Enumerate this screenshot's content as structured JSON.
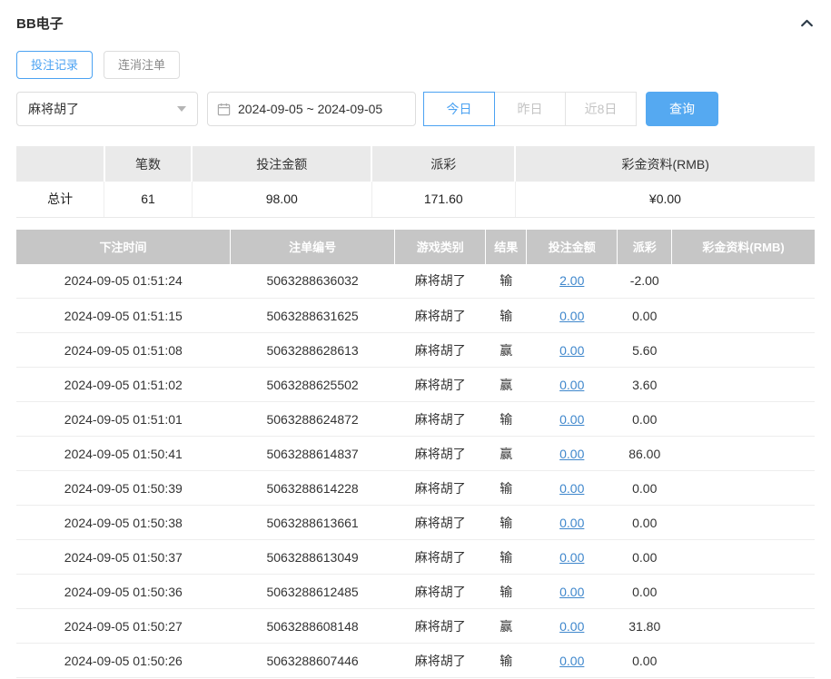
{
  "header": {
    "title": "BB电子"
  },
  "tabs": [
    {
      "label": "投注记录",
      "active": true
    },
    {
      "label": "连消注单",
      "active": false
    }
  ],
  "filters": {
    "game_select": "麻将胡了",
    "date_range": "2024-09-05 ~ 2024-09-05",
    "quick_buttons": [
      {
        "label": "今日",
        "active": true
      },
      {
        "label": "昨日",
        "active": false
      },
      {
        "label": "近8日",
        "active": false
      }
    ],
    "search_label": "查询"
  },
  "summary": {
    "headers": [
      "",
      "笔数",
      "投注金额",
      "派彩",
      "彩金资料(RMB)"
    ],
    "total_label": "总计",
    "count": "61",
    "bet_amount": "98.00",
    "payout": "171.60",
    "bonus": "¥0.00"
  },
  "table": {
    "headers": [
      "下注时间",
      "注单编号",
      "游戏类别",
      "结果",
      "投注金额",
      "派彩",
      "彩金资料(RMB)"
    ],
    "rows": [
      {
        "time": "2024-09-05 01:51:24",
        "order": "5063288636032",
        "game": "麻将胡了",
        "result": "输",
        "bet": "2.00",
        "payout": "-2.00",
        "bonus": ""
      },
      {
        "time": "2024-09-05 01:51:15",
        "order": "5063288631625",
        "game": "麻将胡了",
        "result": "输",
        "bet": "0.00",
        "payout": "0.00",
        "bonus": ""
      },
      {
        "time": "2024-09-05 01:51:08",
        "order": "5063288628613",
        "game": "麻将胡了",
        "result": "赢",
        "bet": "0.00",
        "payout": "5.60",
        "bonus": ""
      },
      {
        "time": "2024-09-05 01:51:02",
        "order": "5063288625502",
        "game": "麻将胡了",
        "result": "赢",
        "bet": "0.00",
        "payout": "3.60",
        "bonus": ""
      },
      {
        "time": "2024-09-05 01:51:01",
        "order": "5063288624872",
        "game": "麻将胡了",
        "result": "输",
        "bet": "0.00",
        "payout": "0.00",
        "bonus": ""
      },
      {
        "time": "2024-09-05 01:50:41",
        "order": "5063288614837",
        "game": "麻将胡了",
        "result": "赢",
        "bet": "0.00",
        "payout": "86.00",
        "bonus": ""
      },
      {
        "time": "2024-09-05 01:50:39",
        "order": "5063288614228",
        "game": "麻将胡了",
        "result": "输",
        "bet": "0.00",
        "payout": "0.00",
        "bonus": ""
      },
      {
        "time": "2024-09-05 01:50:38",
        "order": "5063288613661",
        "game": "麻将胡了",
        "result": "输",
        "bet": "0.00",
        "payout": "0.00",
        "bonus": ""
      },
      {
        "time": "2024-09-05 01:50:37",
        "order": "5063288613049",
        "game": "麻将胡了",
        "result": "输",
        "bet": "0.00",
        "payout": "0.00",
        "bonus": ""
      },
      {
        "time": "2024-09-05 01:50:36",
        "order": "5063288612485",
        "game": "麻将胡了",
        "result": "输",
        "bet": "0.00",
        "payout": "0.00",
        "bonus": ""
      },
      {
        "time": "2024-09-05 01:50:27",
        "order": "5063288608148",
        "game": "麻将胡了",
        "result": "赢",
        "bet": "0.00",
        "payout": "31.80",
        "bonus": ""
      },
      {
        "time": "2024-09-05 01:50:26",
        "order": "5063288607446",
        "game": "麻将胡了",
        "result": "输",
        "bet": "0.00",
        "payout": "0.00",
        "bonus": ""
      }
    ]
  },
  "colors": {
    "accent": "#4ba2f2",
    "link": "#3f87cc",
    "negative": "#e25555",
    "table_header_bg": "#c6c6c6",
    "summary_header_bg": "#eaeaea"
  }
}
